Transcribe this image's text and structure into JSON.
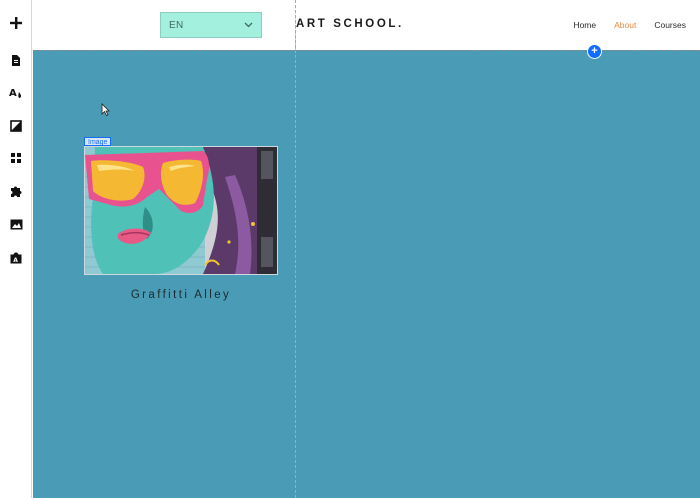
{
  "toolbar": {
    "tools": [
      {
        "icon": "add-icon"
      },
      {
        "icon": "pages-icon"
      },
      {
        "icon": "design-icon"
      },
      {
        "icon": "background-icon"
      },
      {
        "icon": "apps-icon"
      },
      {
        "icon": "puzzle-icon"
      },
      {
        "icon": "media-icon"
      },
      {
        "icon": "blog-icon"
      }
    ]
  },
  "header": {
    "language": "EN",
    "logo": "ART SCHOOL.",
    "nav": [
      "Home",
      "About",
      "Courses"
    ],
    "active_nav": "About"
  },
  "editor": {
    "selection_tag": "Image",
    "add_section_label": "+"
  },
  "content": {
    "image_caption": "Graffitti Alley"
  },
  "colors": {
    "canvas_bg": "#4a9bb5",
    "language_bg": "#a4f0de",
    "nav_active": "#e8893a",
    "accent": "#116dff"
  }
}
